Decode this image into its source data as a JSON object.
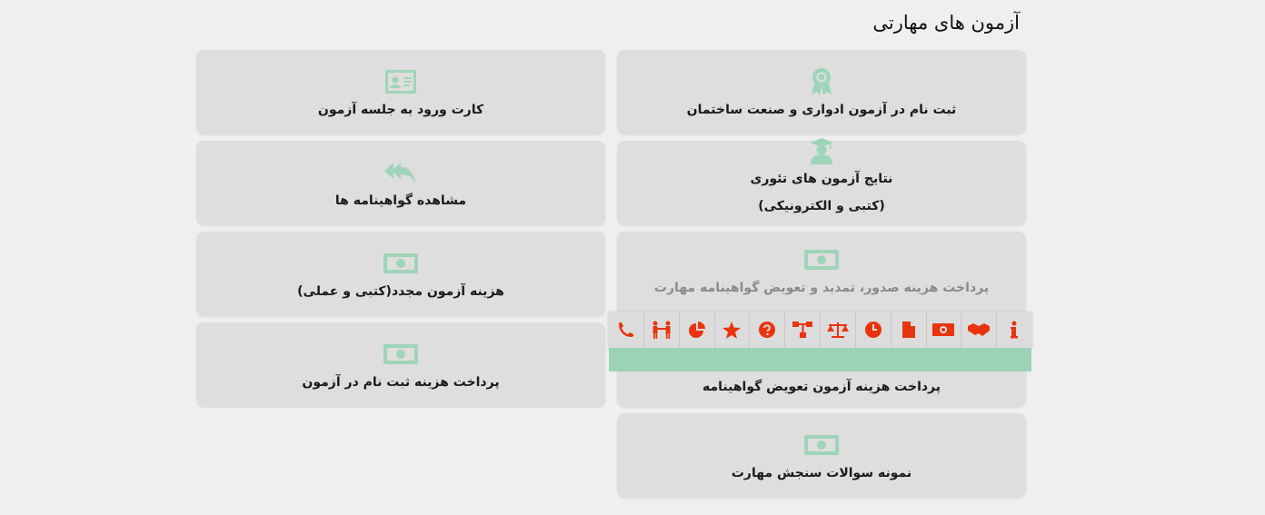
{
  "page": {
    "title": "آزمون های مهارتی"
  },
  "cards": {
    "register_exam": {
      "label": "ثبت نام در آزمون ادواری و صنعت ساختمان",
      "icon": "award-ribbon-icon"
    },
    "entry_card": {
      "label": "کارت ورود به جلسه آزمون",
      "icon": "id-card-icon"
    },
    "theory_results": {
      "label": "نتایج آزمون های تئوری",
      "sub": "(کتبی و الکترونیکی)",
      "icon": "graduate-icon"
    },
    "view_certificates": {
      "label": "مشاهده گواهینامه ها",
      "icon": "reply-all-icon"
    },
    "certificate_fee": {
      "label": "پرداخت هزینه صدور، تمدید و تعویض گواهینامه مهارت",
      "icon": "money-bill-icon"
    },
    "retake_fee": {
      "label": "هزینه آزمون مجدد(کتبی و عملی)",
      "icon": "money-bill-icon"
    },
    "certificate_exchange_fee": {
      "label": "پرداخت هزینه آزمون تعویض گواهینامه",
      "icon": "money-bill-icon"
    },
    "registration_fee": {
      "label": "پرداخت هزینه ثبت نام در آزمون",
      "icon": "money-bill-icon"
    },
    "sample_questions": {
      "label": "نمونه سوالات سنجش مهارت",
      "icon": "money-bill-icon"
    }
  },
  "toolbar": {
    "accent_color": "#e8340f",
    "band_color": "#9cd2b5",
    "items": [
      "info-icon",
      "handshake-icon",
      "money-icon",
      "document-icon",
      "clock-icon",
      "scale-icon",
      "sitemap-icon",
      "question-icon",
      "star-icon",
      "pie-chart-icon",
      "people-icon",
      "phone-icon"
    ]
  }
}
